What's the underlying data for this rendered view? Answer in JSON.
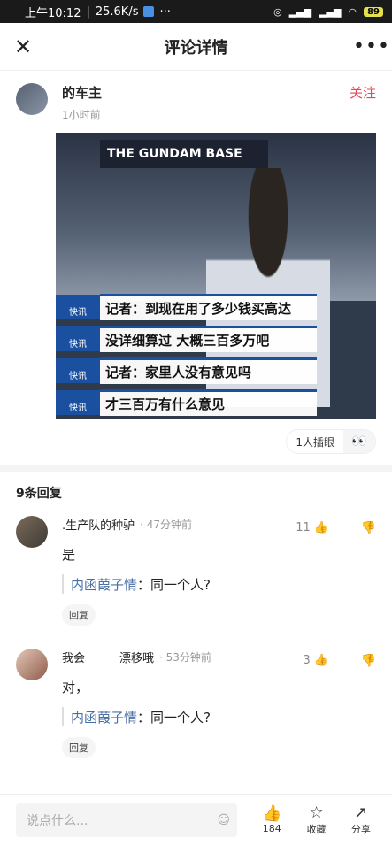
{
  "statusbar": {
    "time": "上午10:12",
    "speed": "25.6K/s",
    "battery": "89"
  },
  "navbar": {
    "title": "评论详情"
  },
  "post": {
    "author": "的车主",
    "time": "1小时前",
    "follow": "关注",
    "image": {
      "sign": "THE GUNDAM BASE",
      "captions": [
        {
          "tag": "快讯",
          "text": "记者：到现在用了多少钱买高达"
        },
        {
          "tag": "快讯",
          "text": "没详细算过 大概三百多万吧"
        },
        {
          "tag": "快讯",
          "text": "记者：家里人没有意见吗"
        },
        {
          "tag": "快讯",
          "text": "才三百万有什么意见"
        }
      ]
    },
    "reaction_label": "1人插眼",
    "reaction_emoji": "👀"
  },
  "replies": {
    "count_label": "9条回复",
    "items": [
      {
        "name": ".生产队的种驴",
        "time": "47分钟前",
        "likes": "11",
        "text": "是",
        "quote_name": "内函葭子情",
        "quote_text": "：同一个人?",
        "reply": "回复"
      },
      {
        "name": "我会______漂移哦",
        "time": "53分钟前",
        "likes": "3",
        "text": "对，",
        "quote_name": "内函葭子情",
        "quote_text": "：同一个人?",
        "reply": "回复"
      }
    ]
  },
  "bottombar": {
    "placeholder": "说点什么...",
    "like_count": "184",
    "favorite": "收藏",
    "share": "分享"
  }
}
